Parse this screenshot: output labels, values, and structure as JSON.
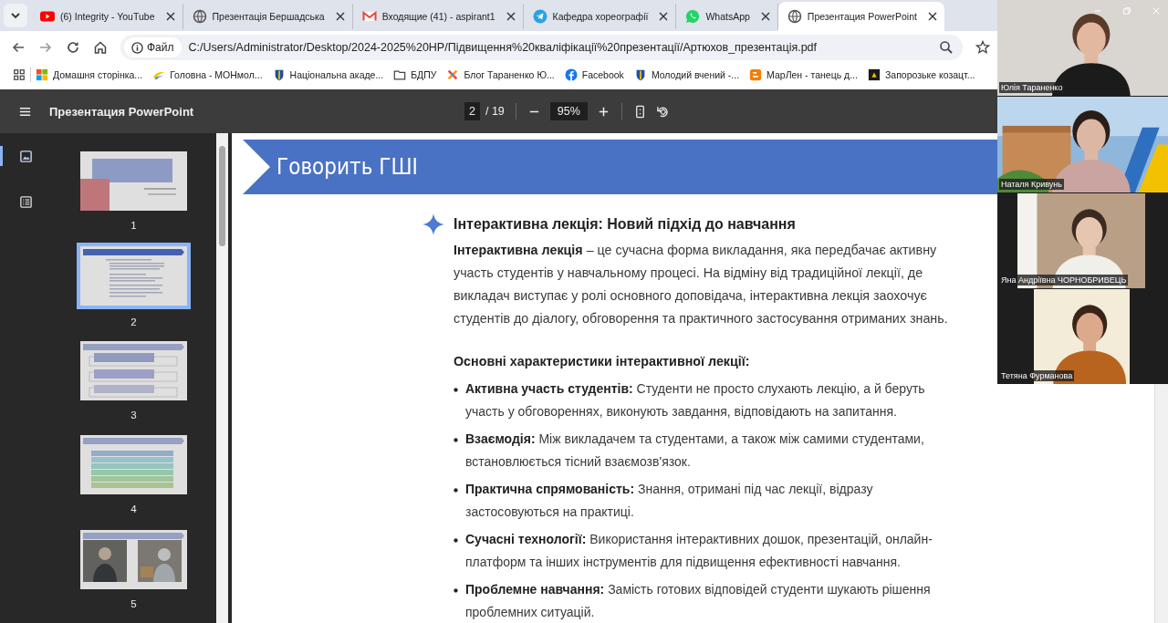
{
  "tabs": [
    {
      "title": "(6) Integrity - YouTube",
      "kind": "youtube",
      "selected": false
    },
    {
      "title": "Презентація Бершадська",
      "kind": "globe",
      "selected": false
    },
    {
      "title": "Входящие (41) - aspirant1",
      "kind": "gmail",
      "selected": false
    },
    {
      "title": "Кафедра хореографії",
      "kind": "telegram",
      "selected": false
    },
    {
      "title": "WhatsApp",
      "kind": "whatsapp",
      "selected": false
    },
    {
      "title": "Презентация PowerPoint",
      "kind": "globe",
      "selected": true
    }
  ],
  "address_bar": {
    "scheme": "Файл",
    "url": "C:/Users/Administrator/Desktop/2024-2025%20НР/Підвищення%20кваліфікації%20презентації/Артюхов_презентація.pdf"
  },
  "bookmarks": [
    {
      "label": "Домашня сторінка...",
      "kind": "windows"
    },
    {
      "label": "Головна - МОНмол...",
      "kind": "swoosh"
    },
    {
      "label": "Національна акаде...",
      "kind": "crest"
    },
    {
      "label": "БДПУ",
      "kind": "folder"
    },
    {
      "label": "Блог Тараненко Ю...",
      "kind": "cross"
    },
    {
      "label": "Facebook",
      "kind": "facebook"
    },
    {
      "label": "Молодий вчений -...",
      "kind": "crest"
    },
    {
      "label": "МарЛен - танець д...",
      "kind": "blogger"
    },
    {
      "label": "Запорозьке козацт...",
      "kind": "dark"
    }
  ],
  "pdf_toolbar": {
    "title": "Презентация PowerPoint",
    "page": "2",
    "page_total": "/ 19",
    "zoom": "95%"
  },
  "sidebar": {
    "views": [
      {
        "kind": "thumbnails",
        "selected": true
      },
      {
        "kind": "outline",
        "selected": false
      }
    ],
    "thumbnails": [
      {
        "number": "1",
        "kind": "title",
        "selected": false
      },
      {
        "number": "2",
        "kind": "text",
        "selected": true
      },
      {
        "number": "3",
        "kind": "boxes",
        "selected": false
      },
      {
        "number": "4",
        "kind": "stripes",
        "selected": false
      },
      {
        "number": "5",
        "kind": "photos",
        "selected": false
      }
    ]
  },
  "slide": {
    "title": "Говорить ГШІ",
    "heading": "Інтерактивна лекція: Новий підхід до навчання",
    "intro": "**Інтерактивна лекція** – це сучасна форма викладання, яка передбачає активну участь студентів у навчальному процесі. На відміну від традиційної лекції, де викладач виступає у ролі основного доповідача, інтерактивна лекція заохочує студентів до діалогу, обговорення та практичного застосування отриманих знань.",
    "subheading": "Основні характеристики інтерактивної лекції:",
    "bullets": [
      "**Активна участь студентів:** Студенти не просто слухають лекцію, а й беруть участь у обговореннях, виконують завдання, відповідають на запитання.",
      "**Взаємодія:** Між викладачем та студентами, а також між самими студентами, встановлюється тісний взаємозв'язок.",
      "**Практична спрямованість:** Знання, отримані під час лекції, відразу застосовуються на практиці.",
      "**Сучасні технології:** Використання інтерактивних дошок, презентацій, онлайн-платформ та інших інструментів для підвищення ефективності навчання.",
      "**Проблемне навчання:** Замість готових відповідей студенти шукають рішення проблемних ситуацій."
    ]
  },
  "video_call": {
    "participants": [
      {
        "name": "Юлія Тараненко",
        "kind": "wall"
      },
      {
        "name": "Наталя Кривунь",
        "kind": "building"
      },
      {
        "name": "Яна Андріївна ЧОРНОБРИВЕЦЬ",
        "kind": "beige"
      },
      {
        "name": "Тетяна Фурманова",
        "kind": "cream"
      }
    ]
  }
}
